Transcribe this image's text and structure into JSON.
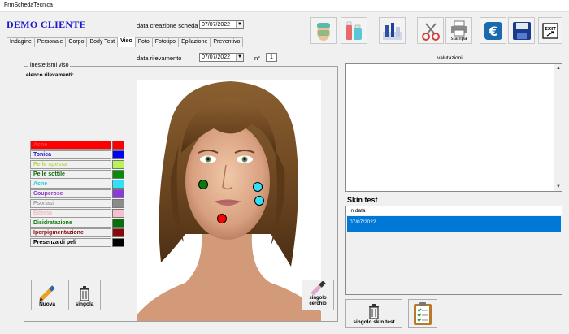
{
  "window": {
    "title": "FrmSchedaTecnica"
  },
  "header": {
    "client_name": "DEMO CLIENTE",
    "creation_label": "data creazione scheda",
    "creation_date": "07/07/2022"
  },
  "tabs": [
    {
      "label": "Indagine"
    },
    {
      "label": "Personale"
    },
    {
      "label": "Corpo"
    },
    {
      "label": "Body Test"
    },
    {
      "label": "Viso",
      "active": true
    },
    {
      "label": "Foto"
    },
    {
      "label": "Fototipo"
    },
    {
      "label": "Epilazione"
    },
    {
      "label": "Preventivo"
    }
  ],
  "toolbar": {
    "stampa_label": "stampa",
    "icons": [
      "face-mask-icon",
      "cosmetics-icon",
      "products-icon",
      "scissors-icon",
      "printer-icon",
      "euro-icon",
      "save-icon",
      "exit-icon"
    ],
    "exit_label": "EXIT"
  },
  "rilevamento": {
    "label": "data rilevamento",
    "date": "07/07/2022",
    "num_label": "n°",
    "num": "1"
  },
  "inestetismi": {
    "group_label": "inestetismi viso",
    "list_label": "elenco rilevamenti:",
    "items": [
      {
        "name": "Acne",
        "color": "#ff0000",
        "text_color": "#ff0000",
        "swatch": "#ff0000",
        "highlighted": true
      },
      {
        "name": "Tonica",
        "text_color": "#1a1acc",
        "swatch": "#0000ff"
      },
      {
        "name": "Pelle spessa",
        "text_color": "#b8d84a",
        "swatch": "#b9f25a"
      },
      {
        "name": "Pelle sottile",
        "text_color": "#0a6a0a",
        "swatch": "#0a8a0a"
      },
      {
        "name": "Acne",
        "text_color": "#2ac8e0",
        "swatch": "#30e0f8"
      },
      {
        "name": "Couperose",
        "text_color": "#8a3ac8",
        "swatch": "#8a3ad8"
      },
      {
        "name": "Psoriasi",
        "text_color": "#888888",
        "swatch": "#8c8c8c"
      },
      {
        "name": "Edema",
        "text_color": "#f0b8c8",
        "swatch": "#f8c0cc"
      },
      {
        "name": "Disidratazione",
        "text_color": "#0a7a0a",
        "swatch": "#087008"
      },
      {
        "name": "Iperpigmentazione",
        "text_color": "#8a0a0a",
        "swatch": "#8a0808"
      },
      {
        "name": "Presenza di peli",
        "text_color": "#000000",
        "swatch": "#000000"
      }
    ],
    "markers": [
      {
        "color": "#0a7a0a"
      },
      {
        "color": "#30e0f8"
      },
      {
        "color": "#30e0f8"
      },
      {
        "color": "#ff0000"
      }
    ]
  },
  "buttons": {
    "nuova": "Nuova",
    "singola": "singola",
    "singolo_cerchio": "singolo cerchio",
    "singolo_skin_test": "singolo skin test"
  },
  "valutazioni": {
    "label": "valutazioni",
    "text": ""
  },
  "skin_test": {
    "title": "Skin test",
    "column": "in data",
    "rows": [
      {
        "date": "07/07/2022",
        "selected": true
      }
    ]
  },
  "colors": {
    "selection": "#0078d7",
    "client_name": "#1a1acc"
  }
}
